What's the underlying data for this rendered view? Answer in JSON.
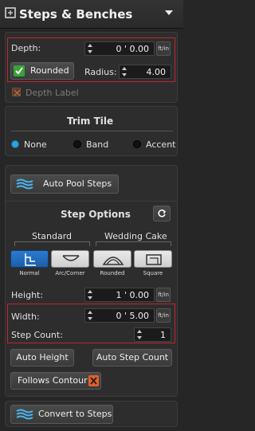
{
  "header": {
    "title": "Steps & Benches",
    "icons": [
      "gear-icon",
      "chevron-down-icon"
    ]
  },
  "depth": {
    "label": "Depth:",
    "value": "0 ' 0.00",
    "unit": "ft/in"
  },
  "rounded": {
    "label": "Rounded",
    "checked": true
  },
  "radius": {
    "label": "Radius:",
    "value": "4.00"
  },
  "depth_label": {
    "label": "Depth Label",
    "checked": false
  },
  "trim": {
    "title": "Trim Tile",
    "options": [
      "None",
      "Band",
      "Accent"
    ],
    "selected": "None"
  },
  "auto_pool_steps": {
    "label": "Auto Pool Steps"
  },
  "step_options": {
    "title": "Step Options",
    "group_standard": "Standard",
    "group_wedding": "Wedding Cake",
    "types": [
      {
        "label": "Normal",
        "icon": "normal-step-icon",
        "selected": true
      },
      {
        "label": "Arc/Corner",
        "icon": "arc-corner-step-icon",
        "selected": false
      },
      {
        "label": "Rounded",
        "icon": "rounded-step-icon",
        "selected": false
      },
      {
        "label": "Square",
        "icon": "square-step-icon",
        "selected": false
      }
    ],
    "height": {
      "label": "Height:",
      "value": "1 ' 0.00",
      "unit": "ft/in"
    },
    "width": {
      "label": "Width:",
      "value": "0 ' 5.00",
      "unit": "ft/in"
    },
    "step_count": {
      "label": "Step Count:",
      "value": "1"
    },
    "auto_height": "Auto Height",
    "auto_step_count": "Auto Step Count",
    "follows_contour": "Follows Contour"
  },
  "convert": {
    "label": "Convert to Steps"
  },
  "colors": {
    "accent_blue": "#2aa3e0",
    "highlight_red": "#c0262f",
    "check_green": "#39a33a",
    "close_orange": "#e0622a"
  }
}
